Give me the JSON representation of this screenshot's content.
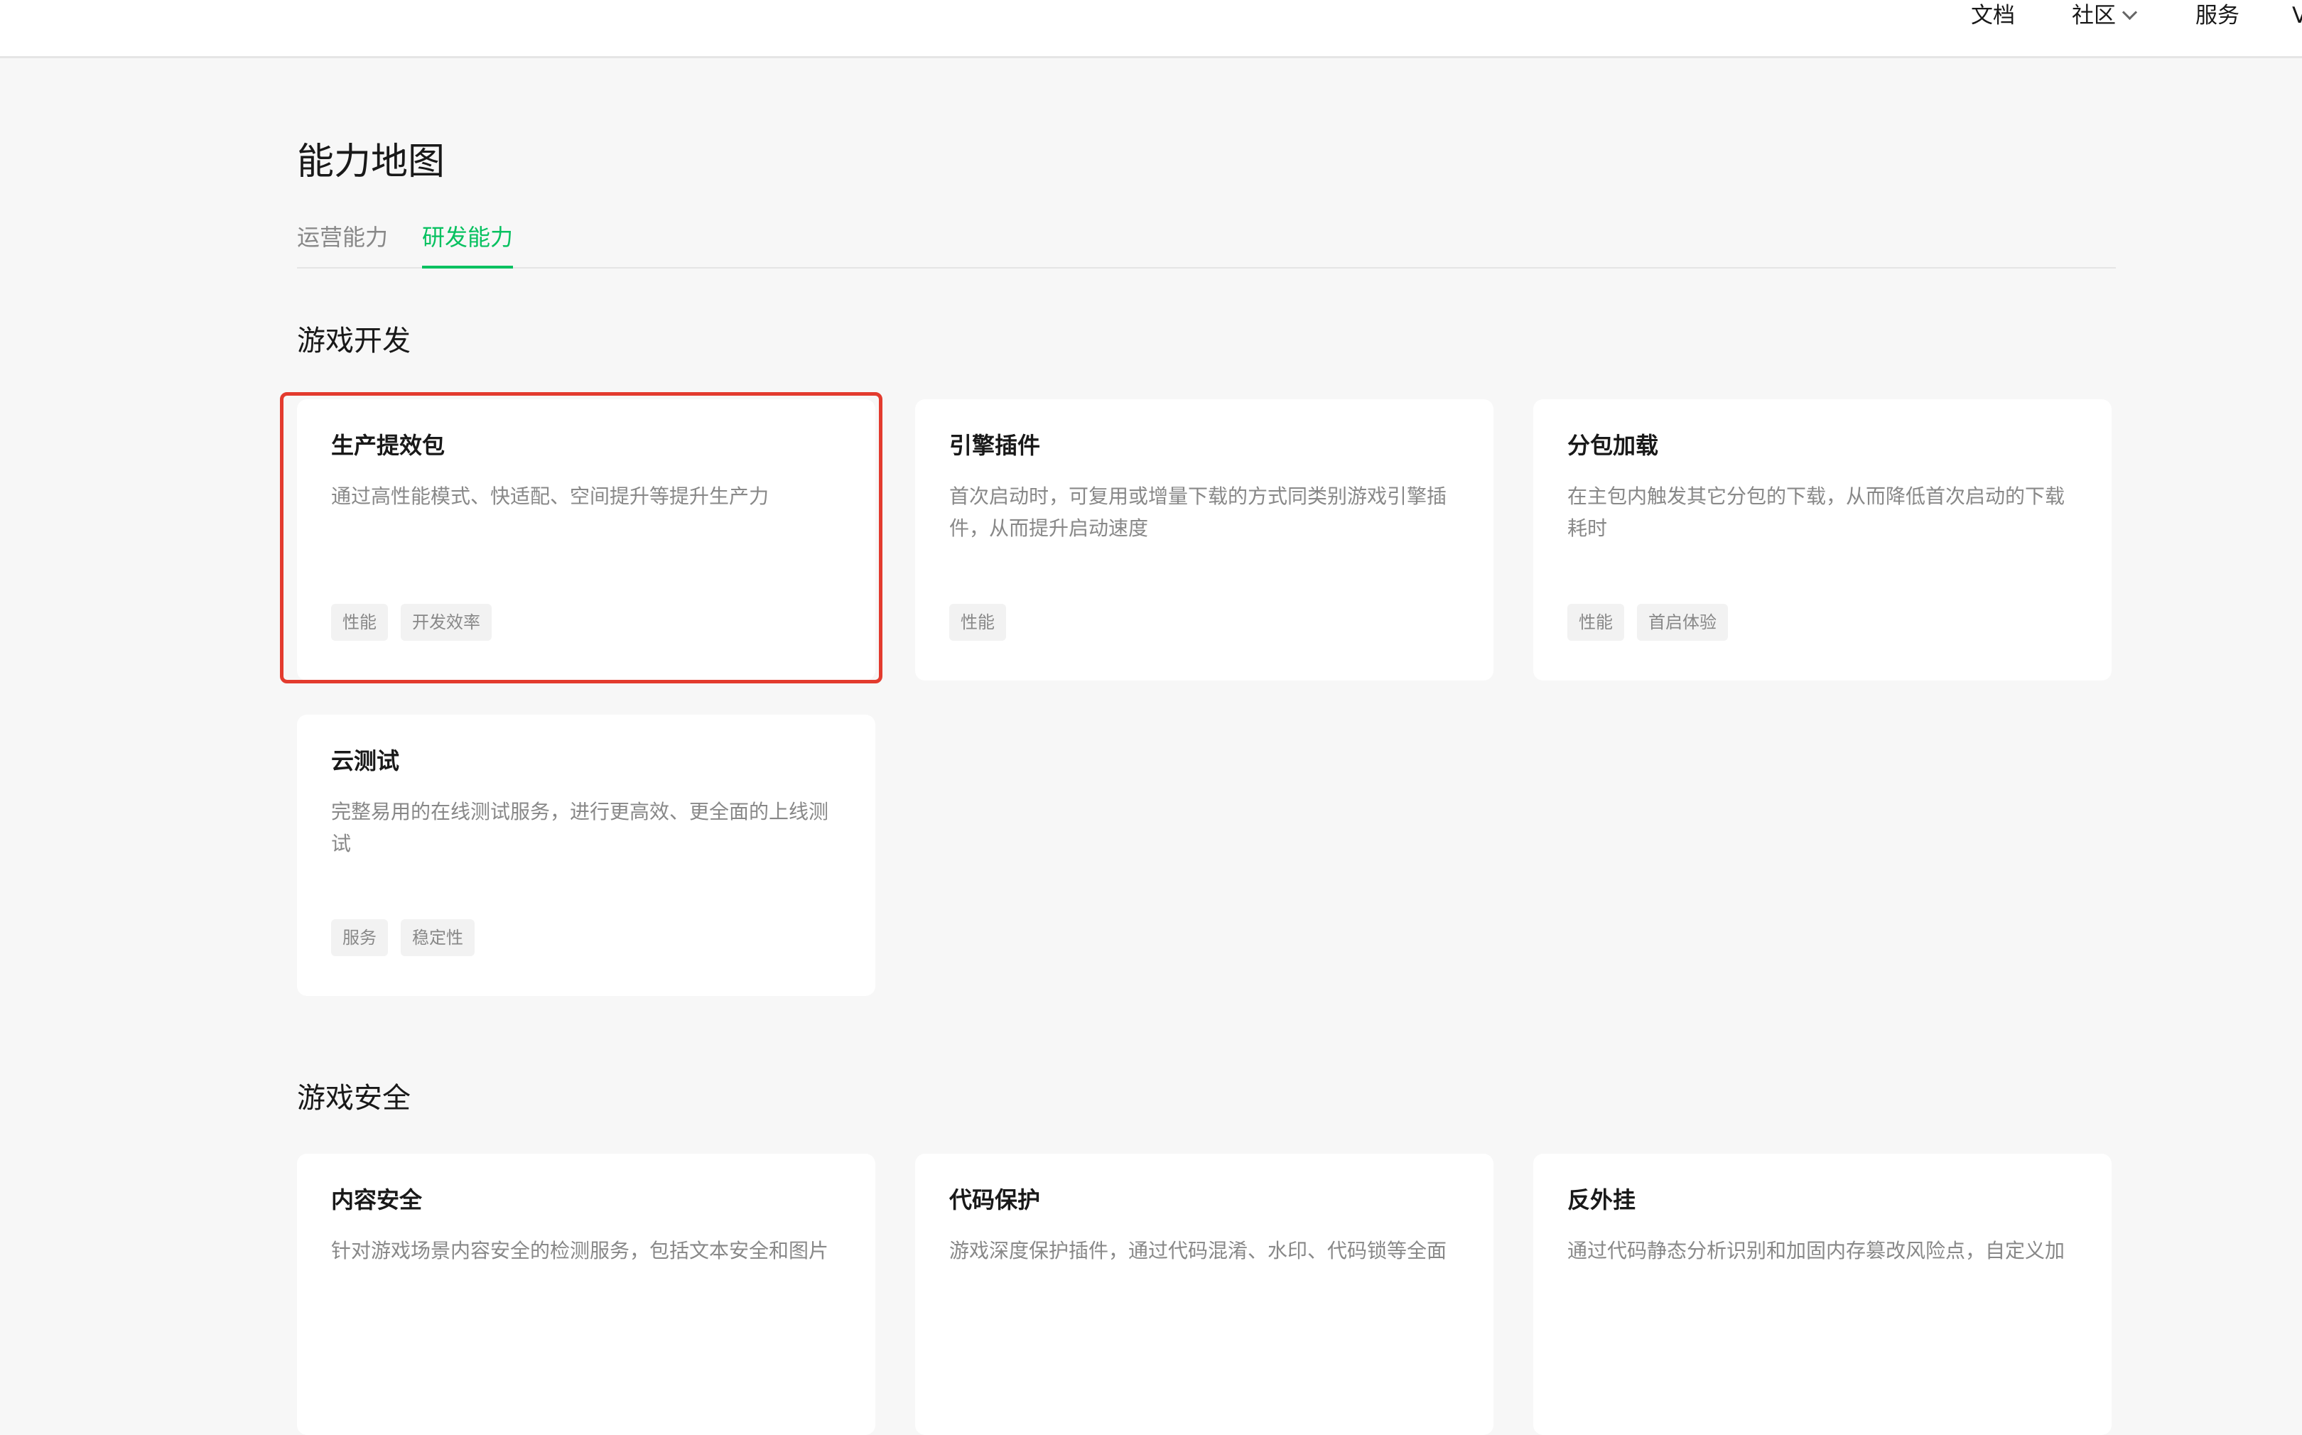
{
  "header": {
    "nav": {
      "docs": "文档",
      "community": "社区",
      "service": "服务",
      "cut": "V"
    }
  },
  "page": {
    "title": "能力地图",
    "tabs": [
      {
        "label": "运营能力",
        "active": false
      },
      {
        "label": "研发能力",
        "active": true
      }
    ],
    "accent_color": "#07c160",
    "highlight_color": "#e33b2e"
  },
  "sections": [
    {
      "title": "游戏开发",
      "cards": [
        {
          "title": "生产提效包",
          "desc": "通过高性能模式、快适配、空间提升等提升生产力",
          "tags": [
            "性能",
            "开发效率"
          ]
        },
        {
          "title": "引擎插件",
          "desc": "首次启动时，可复用或增量下载的方式同类别游戏引擎插件，从而提升启动速度",
          "tags": [
            "性能"
          ]
        },
        {
          "title": "分包加载",
          "desc": "在主包内触发其它分包的下载，从而降低首次启动的下载耗时",
          "tags": [
            "性能",
            "首启体验"
          ]
        },
        {
          "title": "云测试",
          "desc": "完整易用的在线测试服务，进行更高效、更全面的上线测试",
          "tags": [
            "服务",
            "稳定性"
          ]
        }
      ]
    },
    {
      "title": "游戏安全",
      "cards": [
        {
          "title": "内容安全",
          "desc": "针对游戏场景内容安全的检测服务，包括文本安全和图片",
          "tags": []
        },
        {
          "title": "代码保护",
          "desc": "游戏深度保护插件，通过代码混淆、水印、代码锁等全面",
          "tags": []
        },
        {
          "title": "反外挂",
          "desc": "通过代码静态分析识别和加固内存篡改风险点，自定义加",
          "tags": []
        }
      ]
    }
  ]
}
